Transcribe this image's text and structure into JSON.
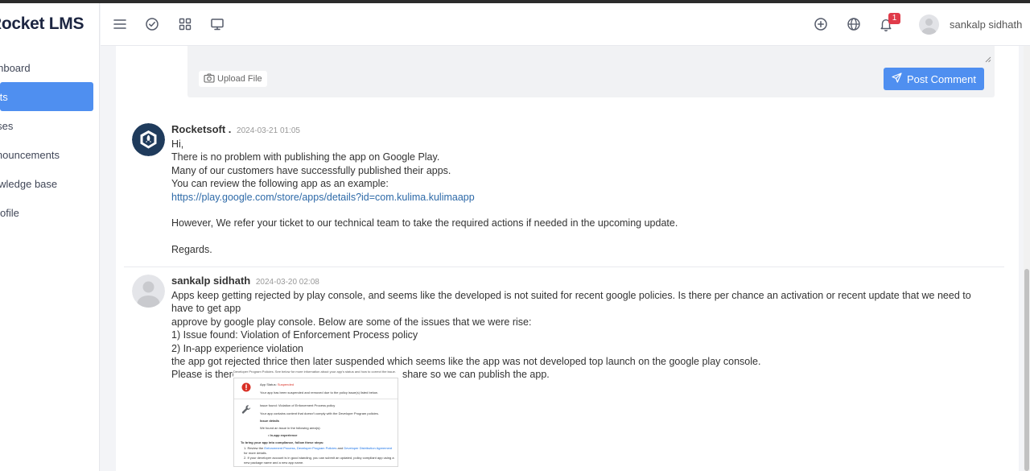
{
  "app": {
    "logo_text": "Rocket LMS"
  },
  "sidebar": {
    "items": [
      {
        "label": "Dashboard"
      },
      {
        "label": "Tickets"
      },
      {
        "label": "Courses"
      },
      {
        "label": "Announcements"
      },
      {
        "label": "Knowledge base"
      },
      {
        "label": "Profile"
      }
    ]
  },
  "header": {
    "notification_count": "1",
    "user_name": "sankalp sidhath"
  },
  "reply": {
    "upload_label": "Upload File",
    "post_label": "Post Comment"
  },
  "comments": [
    {
      "author": "Rocketsoft .",
      "date": "2024-03-21 01:05",
      "lines": [
        "Hi,",
        "There is no problem with publishing the app on Google Play.",
        "Many of our customers have successfully published their apps.",
        "You can review the following app as an example:",
        "https://play.google.com/store/apps/details?id=com.kulima.kulimaapp",
        "",
        "However, We refer your ticket to our technical team to take the required actions if needed in the upcoming update.",
        "",
        "Regards."
      ]
    },
    {
      "author": "sankalp sidhath",
      "date": "2024-03-20 02:08",
      "lines": [
        "Apps keep getting rejected by play console, and seems like the developed is not suited for recent google policies. Is there per chance an activation or recent update that we need to have to get app",
        "approve by google play console. Below are some of the issues that we were rise:",
        "1) Issue found: Violation of Enforcement Process policy",
        "2) In-app experience violation",
        "the app got rejected thrice then later suspended which seems like the app was not developed top launch on the google play console.",
        "Please is there is anything we need to know please share so we can publish the app."
      ],
      "attachment": {
        "caption": "Developer Program Policies. See below for more information about your app's status and how to correct the issue.",
        "status_label": "App Status:",
        "status_value": "Suspended",
        "status_desc": "Your app has been suspended and removed due to the policy issue(s) listed below.",
        "issue_title": "Issue found: Violation of Enforcement Process policy",
        "issue_desc": "Your app contains content that doesn't comply with the Developer Program policies.",
        "details_heading": "Issue details",
        "details_intro": "We found an issue in the following area(s):",
        "details_item": "In-app experience",
        "steps_heading": "To bring your app into compliance, follow these steps:",
        "step1_prefix": "1. Review the",
        "step1_link1": "Enforcement Process, Developer Program Policies",
        "step1_mid": "and",
        "step1_link2": "Developer Distribution Agreement",
        "step1_suffix": "for more details.",
        "step2": "2. If your developer account is in good standing, you can submit an updated, policy compliant app using a new package name and a new app name."
      }
    }
  ],
  "colors": {
    "accent": "#4f8ff0",
    "link": "#2e6aa8",
    "badge": "#e03b4a",
    "logo": "#1c2541"
  }
}
